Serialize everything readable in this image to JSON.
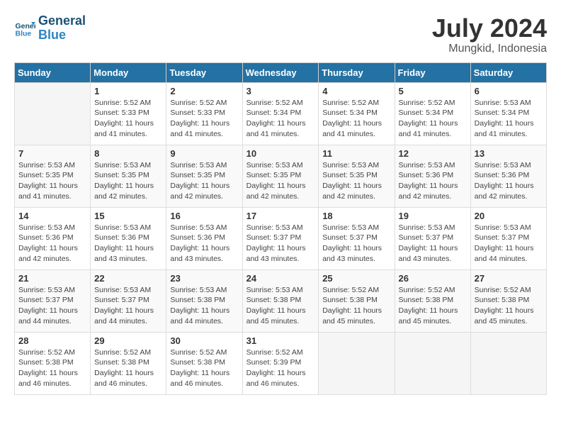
{
  "header": {
    "logo_line1": "General",
    "logo_line2": "Blue",
    "month_year": "July 2024",
    "location": "Mungkid, Indonesia"
  },
  "days_of_week": [
    "Sunday",
    "Monday",
    "Tuesday",
    "Wednesday",
    "Thursday",
    "Friday",
    "Saturday"
  ],
  "weeks": [
    [
      {
        "day": "",
        "info": ""
      },
      {
        "day": "1",
        "info": "Sunrise: 5:52 AM\nSunset: 5:33 PM\nDaylight: 11 hours\nand 41 minutes."
      },
      {
        "day": "2",
        "info": "Sunrise: 5:52 AM\nSunset: 5:33 PM\nDaylight: 11 hours\nand 41 minutes."
      },
      {
        "day": "3",
        "info": "Sunrise: 5:52 AM\nSunset: 5:34 PM\nDaylight: 11 hours\nand 41 minutes."
      },
      {
        "day": "4",
        "info": "Sunrise: 5:52 AM\nSunset: 5:34 PM\nDaylight: 11 hours\nand 41 minutes."
      },
      {
        "day": "5",
        "info": "Sunrise: 5:52 AM\nSunset: 5:34 PM\nDaylight: 11 hours\nand 41 minutes."
      },
      {
        "day": "6",
        "info": "Sunrise: 5:53 AM\nSunset: 5:34 PM\nDaylight: 11 hours\nand 41 minutes."
      }
    ],
    [
      {
        "day": "7",
        "info": "Sunrise: 5:53 AM\nSunset: 5:35 PM\nDaylight: 11 hours\nand 41 minutes."
      },
      {
        "day": "8",
        "info": "Sunrise: 5:53 AM\nSunset: 5:35 PM\nDaylight: 11 hours\nand 42 minutes."
      },
      {
        "day": "9",
        "info": "Sunrise: 5:53 AM\nSunset: 5:35 PM\nDaylight: 11 hours\nand 42 minutes."
      },
      {
        "day": "10",
        "info": "Sunrise: 5:53 AM\nSunset: 5:35 PM\nDaylight: 11 hours\nand 42 minutes."
      },
      {
        "day": "11",
        "info": "Sunrise: 5:53 AM\nSunset: 5:35 PM\nDaylight: 11 hours\nand 42 minutes."
      },
      {
        "day": "12",
        "info": "Sunrise: 5:53 AM\nSunset: 5:36 PM\nDaylight: 11 hours\nand 42 minutes."
      },
      {
        "day": "13",
        "info": "Sunrise: 5:53 AM\nSunset: 5:36 PM\nDaylight: 11 hours\nand 42 minutes."
      }
    ],
    [
      {
        "day": "14",
        "info": "Sunrise: 5:53 AM\nSunset: 5:36 PM\nDaylight: 11 hours\nand 42 minutes."
      },
      {
        "day": "15",
        "info": "Sunrise: 5:53 AM\nSunset: 5:36 PM\nDaylight: 11 hours\nand 43 minutes."
      },
      {
        "day": "16",
        "info": "Sunrise: 5:53 AM\nSunset: 5:36 PM\nDaylight: 11 hours\nand 43 minutes."
      },
      {
        "day": "17",
        "info": "Sunrise: 5:53 AM\nSunset: 5:37 PM\nDaylight: 11 hours\nand 43 minutes."
      },
      {
        "day": "18",
        "info": "Sunrise: 5:53 AM\nSunset: 5:37 PM\nDaylight: 11 hours\nand 43 minutes."
      },
      {
        "day": "19",
        "info": "Sunrise: 5:53 AM\nSunset: 5:37 PM\nDaylight: 11 hours\nand 43 minutes."
      },
      {
        "day": "20",
        "info": "Sunrise: 5:53 AM\nSunset: 5:37 PM\nDaylight: 11 hours\nand 44 minutes."
      }
    ],
    [
      {
        "day": "21",
        "info": "Sunrise: 5:53 AM\nSunset: 5:37 PM\nDaylight: 11 hours\nand 44 minutes."
      },
      {
        "day": "22",
        "info": "Sunrise: 5:53 AM\nSunset: 5:37 PM\nDaylight: 11 hours\nand 44 minutes."
      },
      {
        "day": "23",
        "info": "Sunrise: 5:53 AM\nSunset: 5:38 PM\nDaylight: 11 hours\nand 44 minutes."
      },
      {
        "day": "24",
        "info": "Sunrise: 5:53 AM\nSunset: 5:38 PM\nDaylight: 11 hours\nand 45 minutes."
      },
      {
        "day": "25",
        "info": "Sunrise: 5:52 AM\nSunset: 5:38 PM\nDaylight: 11 hours\nand 45 minutes."
      },
      {
        "day": "26",
        "info": "Sunrise: 5:52 AM\nSunset: 5:38 PM\nDaylight: 11 hours\nand 45 minutes."
      },
      {
        "day": "27",
        "info": "Sunrise: 5:52 AM\nSunset: 5:38 PM\nDaylight: 11 hours\nand 45 minutes."
      }
    ],
    [
      {
        "day": "28",
        "info": "Sunrise: 5:52 AM\nSunset: 5:38 PM\nDaylight: 11 hours\nand 46 minutes."
      },
      {
        "day": "29",
        "info": "Sunrise: 5:52 AM\nSunset: 5:38 PM\nDaylight: 11 hours\nand 46 minutes."
      },
      {
        "day": "30",
        "info": "Sunrise: 5:52 AM\nSunset: 5:38 PM\nDaylight: 11 hours\nand 46 minutes."
      },
      {
        "day": "31",
        "info": "Sunrise: 5:52 AM\nSunset: 5:39 PM\nDaylight: 11 hours\nand 46 minutes."
      },
      {
        "day": "",
        "info": ""
      },
      {
        "day": "",
        "info": ""
      },
      {
        "day": "",
        "info": ""
      }
    ]
  ]
}
